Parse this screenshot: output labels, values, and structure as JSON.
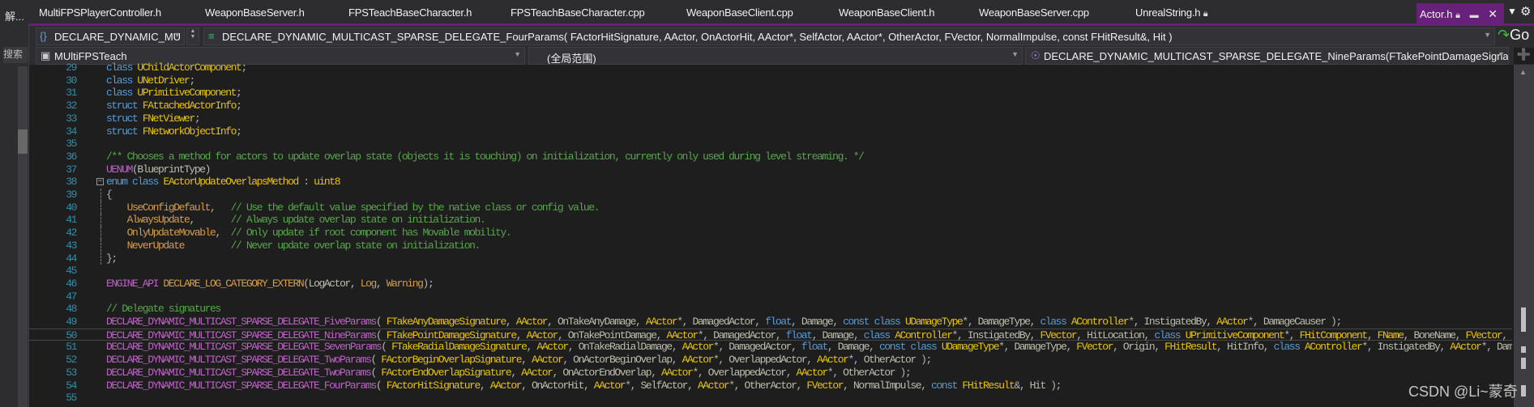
{
  "left_panel": {
    "title": "解...",
    "search_label": "搜索"
  },
  "tabs": [
    {
      "label": "MultiFPSPlayerController.h"
    },
    {
      "label": "WeaponBaseServer.h"
    },
    {
      "label": "FPSTeachBaseCharacter.h"
    },
    {
      "label": "FPSTeachBaseCharacter.cpp"
    },
    {
      "label": "WeaponBaseClient.cpp"
    },
    {
      "label": "WeaponBaseClient.h"
    },
    {
      "label": "WeaponBaseServer.cpp"
    },
    {
      "label": "UnrealString.h",
      "locked": true
    }
  ],
  "active_tab": {
    "label": "Actor.h",
    "locked": true,
    "icons": [
      "lock-icon",
      "pin-icon",
      "close-icon"
    ]
  },
  "tab_overflow_icons": [
    "dropdown-icon",
    "gear-icon"
  ],
  "toolbar": {
    "scope_combo": "DECLARE_DYNAMIC_MU",
    "member_combo": "DECLARE_DYNAMIC_MULTICAST_SPARSE_DELEGATE_FourParams( FActorHitSignature, AActor, OnActorHit, AActor*, SelfActor, AActor*, OtherActor, FVector, NormalImpulse, const FHitResult&, Hit )",
    "go_label": "Go"
  },
  "navbar": {
    "project": "MUltiFPSTeach",
    "scope": "(全局范围)",
    "member": "DECLARE_DYNAMIC_MULTICAST_SPARSE_DELEGATE_NineParams(FTakePointDamageSignature, AA"
  },
  "editor": {
    "current_line": 50,
    "lines": [
      {
        "n": 29,
        "text": "class UChildActorComponent;"
      },
      {
        "n": 30,
        "text": "class UNetDriver;"
      },
      {
        "n": 31,
        "text": "class UPrimitiveComponent;"
      },
      {
        "n": 32,
        "text": "struct FAttachedActorInfo;"
      },
      {
        "n": 33,
        "text": "struct FNetViewer;"
      },
      {
        "n": 34,
        "text": "struct FNetworkObjectInfo;"
      },
      {
        "n": 35,
        "text": ""
      },
      {
        "n": 36,
        "text": "/** Chooses a method for actors to update overlap state (objects it is touching) on initialization, currently only used during level streaming. */"
      },
      {
        "n": 37,
        "text": "UENUM(BlueprintType)"
      },
      {
        "n": 38,
        "text": "enum class EActorUpdateOverlapsMethod : uint8"
      },
      {
        "n": 39,
        "text": "{"
      },
      {
        "n": 40,
        "text": "    UseConfigDefault,   // Use the default value specified by the native class or config value."
      },
      {
        "n": 41,
        "text": "    AlwaysUpdate,       // Always update overlap state on initialization."
      },
      {
        "n": 42,
        "text": "    OnlyUpdateMovable,  // Only update if root component has Movable mobility."
      },
      {
        "n": 43,
        "text": "    NeverUpdate         // Never update overlap state on initialization."
      },
      {
        "n": 44,
        "text": "};"
      },
      {
        "n": 45,
        "text": ""
      },
      {
        "n": 46,
        "text": "ENGINE_API DECLARE_LOG_CATEGORY_EXTERN(LogActor, Log, Warning);"
      },
      {
        "n": 47,
        "text": ""
      },
      {
        "n": 48,
        "text": "// Delegate signatures"
      },
      {
        "n": 49,
        "text": "DECLARE_DYNAMIC_MULTICAST_SPARSE_DELEGATE_FiveParams( FTakeAnyDamageSignature, AActor, OnTakeAnyDamage, AActor*, DamagedActor, float, Damage, const class UDamageType*, DamageType, class AController*, InstigatedBy, AActor*, DamageCauser );"
      },
      {
        "n": 50,
        "text": "DECLARE_DYNAMIC_MULTICAST_SPARSE_DELEGATE_NineParams( FTakePointDamageSignature, AActor, OnTakePointDamage, AActor*, DamagedActor, float, Damage, class AController*, InstigatedBy, FVector, HitLocation, class UPrimitiveComponent*, FHitComponent, FName, BoneName, FVector, S"
      },
      {
        "n": 51,
        "text": "DECLARE_DYNAMIC_MULTICAST_SPARSE_DELEGATE_SevenParams( FTakeRadialDamageSignature, AActor, OnTakeRadialDamage, AActor*, DamagedActor, float, Damage, const class UDamageType*, DamageType, FVector, Origin, FHitResult, HitInfo, class AController*, InstigatedBy, AActor*, Dama"
      },
      {
        "n": 52,
        "text": "DECLARE_DYNAMIC_MULTICAST_SPARSE_DELEGATE_TwoParams( FActorBeginOverlapSignature, AActor, OnActorBeginOverlap, AActor*, OverlappedActor, AActor*, OtherActor );"
      },
      {
        "n": 53,
        "text": "DECLARE_DYNAMIC_MULTICAST_SPARSE_DELEGATE_TwoParams( FActorEndOverlapSignature, AActor, OnActorEndOverlap, AActor*, OverlappedActor, AActor*, OtherActor );"
      },
      {
        "n": 54,
        "text": "DECLARE_DYNAMIC_MULTICAST_SPARSE_DELEGATE_FourParams( FActorHitSignature, AActor, OnActorHit, AActor*, SelfActor, AActor*, OtherActor, FVector, NormalImpulse, const FHitResult&, Hit );"
      },
      {
        "n": 55,
        "text": ""
      }
    ]
  },
  "colors": {
    "accent": "#68217a",
    "keyword": "#569cd6",
    "type": "#e8c400",
    "macro": "#bd63c5",
    "comment": "#57a64a",
    "enum_member": "#d69d45",
    "line_number": "#2b91af",
    "identifier": "#bdbdad"
  },
  "watermark": "CSDN @Li~蒙奇"
}
